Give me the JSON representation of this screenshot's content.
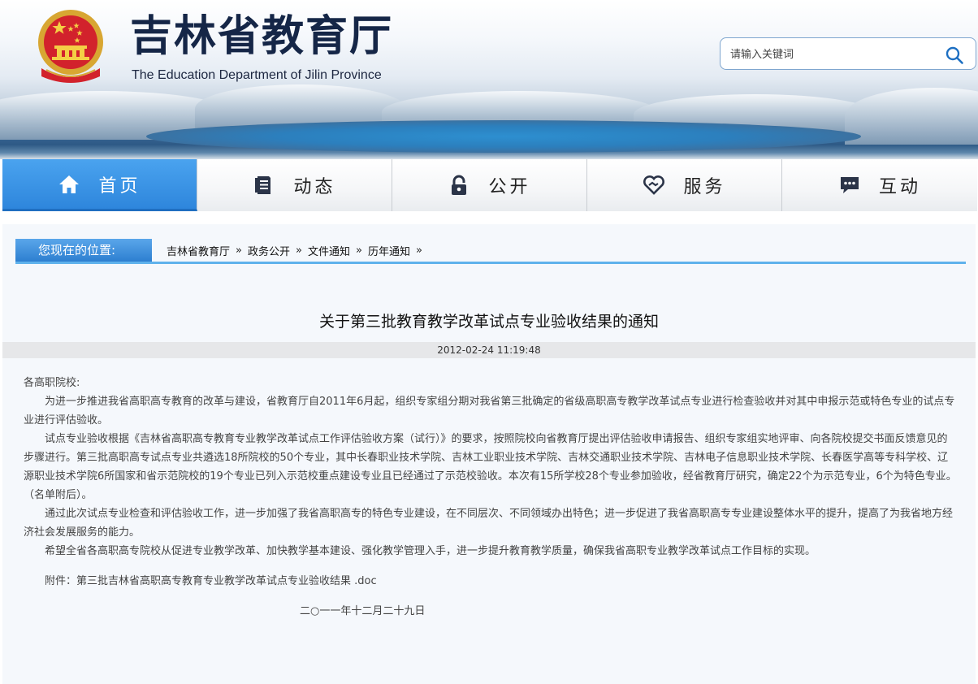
{
  "header": {
    "title_cn": "吉林省教育厅",
    "title_en": "The Education Department of Jilin Province",
    "search_placeholder": "请输入关键词",
    "emblem_icon": "national-emblem-icon"
  },
  "nav": {
    "items": [
      {
        "label": "首页",
        "icon": "home-icon",
        "active": true
      },
      {
        "label": "动态",
        "icon": "document-icon",
        "active": false
      },
      {
        "label": "公开",
        "icon": "lock-icon",
        "active": false
      },
      {
        "label": "服务",
        "icon": "heart-handshake-icon",
        "active": false
      },
      {
        "label": "互动",
        "icon": "chat-icon",
        "active": false
      }
    ],
    "active_color": "#2e86dc"
  },
  "breadcrumb": {
    "label": "您现在的位置:",
    "items": [
      "吉林省教育厅",
      "政务公开",
      "文件通知",
      "历年通知"
    ],
    "separator": "»"
  },
  "article": {
    "title": "关于第三批教育教学改革试点专业验收结果的通知",
    "date": "2012-02-24 11:19:48",
    "salutation": "各高职院校:",
    "paragraphs": [
      "为进一步推进我省高职高专教育的改革与建设，省教育厅自2011年6月起，组织专家组分期对我省第三批确定的省级高职高专教学改革试点专业进行检查验收并对其中申报示范或特色专业的试点专业进行评估验收。",
      "试点专业验收根据《吉林省高职高专教育专业教学改革试点工作评估验收方案（试行）》的要求，按照院校向省教育厅提出评估验收申请报告、组织专家组实地评审、向各院校提交书面反馈意见的步骤进行。第三批高职高专试点专业共遴选18所院校的50个专业，其中长春职业技术学院、吉林工业职业技术学院、吉林交通职业技术学院、吉林电子信息职业技术学院、长春医学高等专科学校、辽源职业技术学院6所国家和省示范院校的19个专业已列入示范校重点建设专业且已经通过了示范校验收。本次有15所学校28个专业参加验收，经省教育厅研究，确定22个为示范专业，6个为特色专业。（名单附后）。",
      "通过此次试点专业检查和评估验收工作，进一步加强了我省高职高专的特色专业建设，在不同层次、不同领域办出特色；进一步促进了我省高职高专专业建设整体水平的提升，提高了为我省地方经济社会发展服务的能力。",
      "希望全省各高职高专院校从促进专业教学改革、加快教学基本建设、强化教学管理入手，进一步提升教育教学质量，确保我省高职专业教学改革试点工作目标的实现。"
    ],
    "attachment": "附件：第三批吉林省高职高专教育专业教学改革试点专业验收结果 .doc",
    "signature_date": "二○一一年十二月二十九日"
  }
}
